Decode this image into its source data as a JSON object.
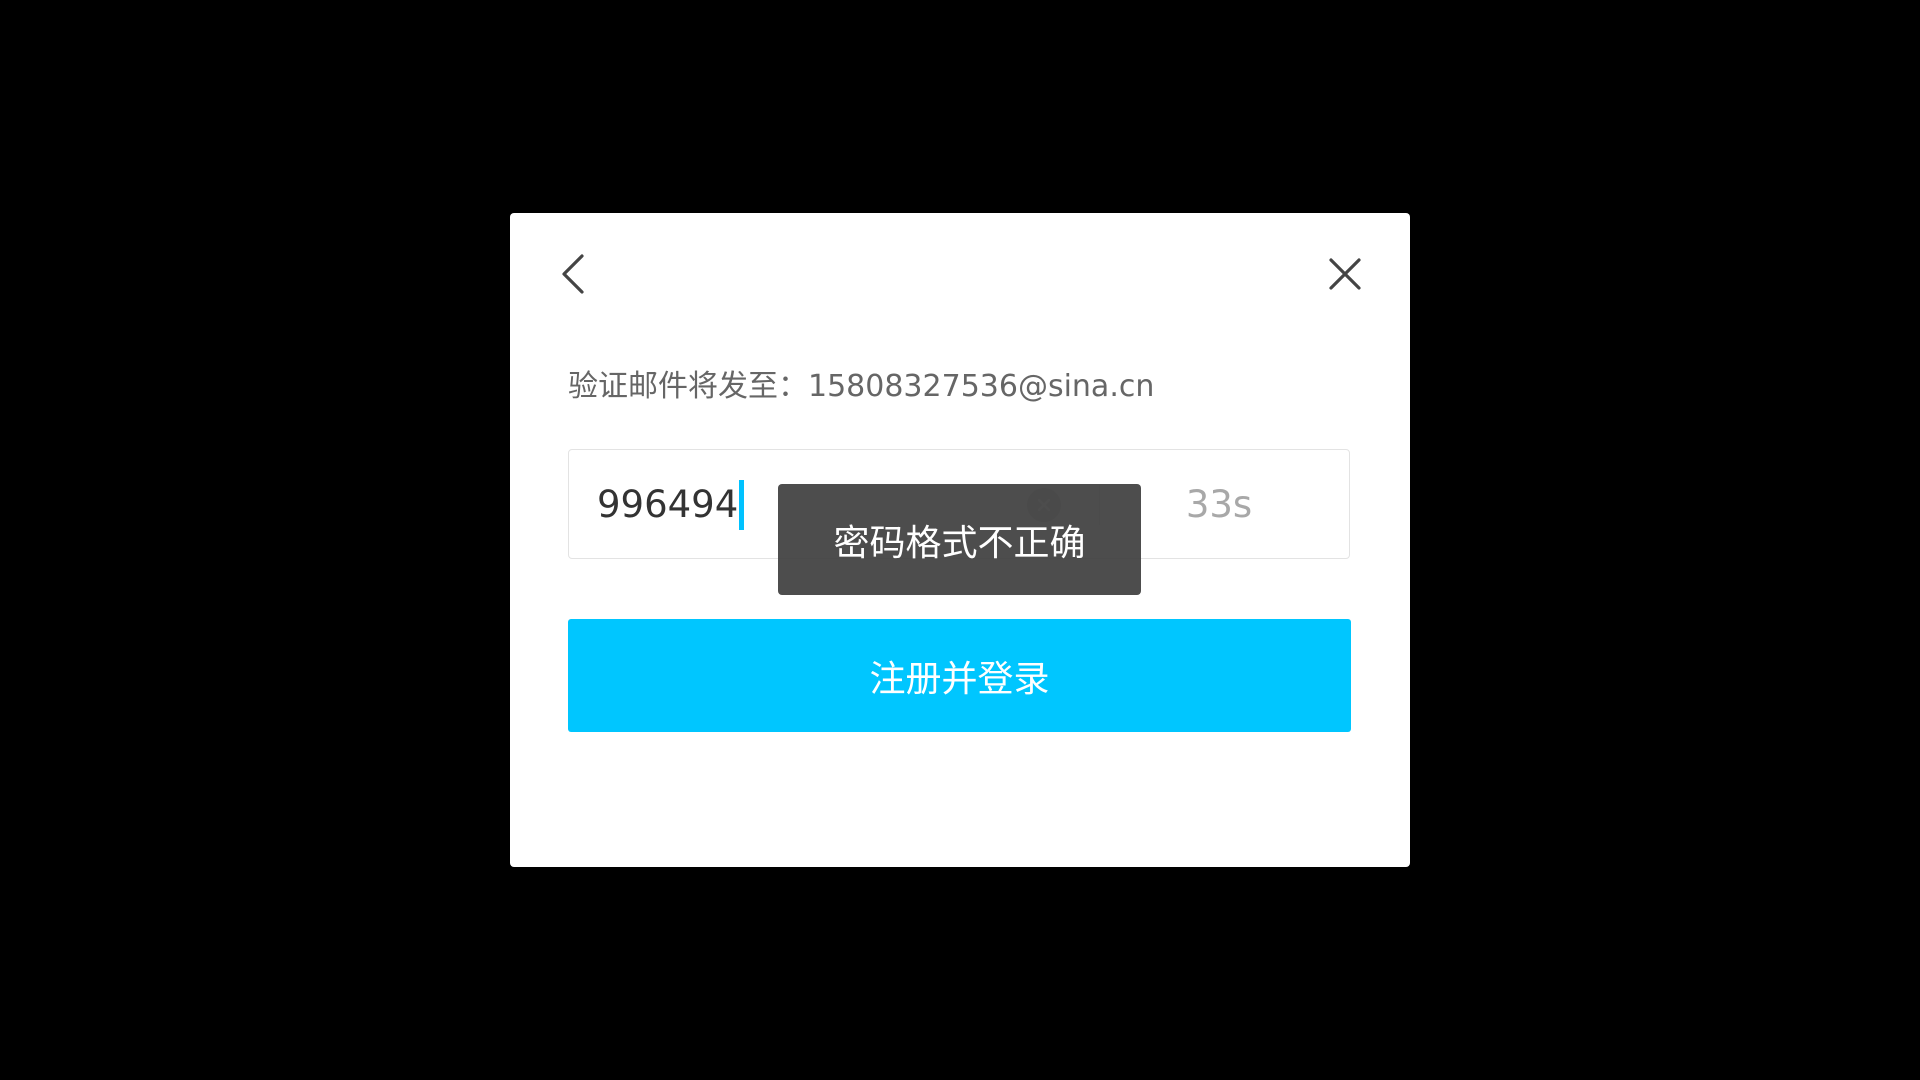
{
  "dialog": {
    "back_icon": "chevron-left-icon",
    "close_icon": "close-icon",
    "hint_text": "验证邮件将发至：15808327536@sina.cn",
    "code_input": {
      "value": "996494",
      "clear_icon": "clear-circle-icon",
      "countdown": "33s"
    },
    "submit_label": "注册并登录"
  },
  "toast": {
    "message": "密码格式不正确"
  },
  "colors": {
    "accent": "#00c6ff",
    "caret": "#00c2ff",
    "overlay_bg": "#000000",
    "toast_bg": "#404040"
  }
}
